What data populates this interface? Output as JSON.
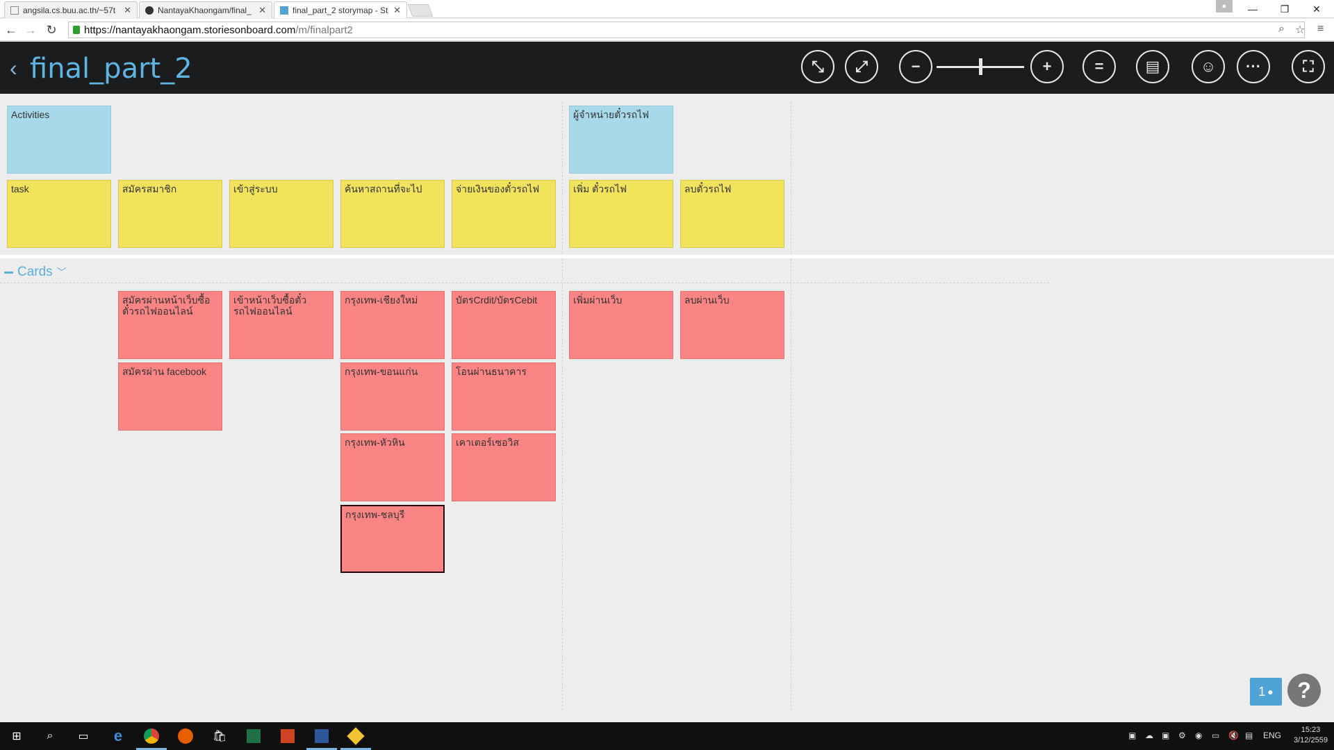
{
  "browser": {
    "tabs": [
      {
        "title": "angsila.cs.buu.ac.th/~57t",
        "active": false
      },
      {
        "title": "NantayaKhaongam/final_",
        "active": false
      },
      {
        "title": "final_part_2 storymap - St",
        "active": true
      }
    ],
    "url_host": "https://nantayakhaongam.storiesonboard.com",
    "url_path": "/m/finalpart2"
  },
  "header": {
    "title": "final_part_2",
    "buttons": [
      "collapse-icon",
      "expand-icon",
      "zoom-out-icon",
      "zoom-in-icon",
      "equal-icon",
      "notes-icon",
      "user-icon",
      "more-icon",
      "fullscreen-icon"
    ],
    "zoom_level": 0.5
  },
  "board": {
    "activities": [
      {
        "label": "Activities"
      },
      {
        "label": "ผู้จำหน่ายตั๋วรถไฟ"
      }
    ],
    "tasks": [
      {
        "label": "task"
      },
      {
        "label": "สมัครสมาชิก"
      },
      {
        "label": "เข้าสู่ระบบ"
      },
      {
        "label": "ค้นหาสถานที่จะไป"
      },
      {
        "label": "จ่ายเงินของตั๋วรถไฟ"
      },
      {
        "label": "เพิ่ม ตั๋วรถไฟ"
      },
      {
        "label": "ลบตั๋วรถไฟ"
      }
    ],
    "release_label": "Cards",
    "cards": [
      {
        "label": "สมัครผ่านหน้าเว็บซื้อตั๋วรถไฟออนไลน์"
      },
      {
        "label": "สมัครผ่าน facebook"
      },
      {
        "label": "เข้าหน้าเว็บซื้อตั๋วรถไฟออนไลน์"
      },
      {
        "label": "กรุงเทพ-เชียงใหม่"
      },
      {
        "label": "กรุงเทพ-ขอนแก่น"
      },
      {
        "label": "กรุงเทพ-หัวหิน"
      },
      {
        "label": "กรุงเทพ-ชลบุรี"
      },
      {
        "label": "บัตรCrdit/บัตรCebit"
      },
      {
        "label": "โอนผ่านธนาคาร"
      },
      {
        "label": "เคาเตอร์เซอวิส"
      },
      {
        "label": "เพิ่มผ่านเว็บ"
      },
      {
        "label": "ลบผ่านเว็บ"
      }
    ]
  },
  "floating": {
    "users_count": "1",
    "help": "?"
  },
  "taskbar": {
    "lang": "ENG",
    "time": "15:23",
    "date": "3/12/2559"
  },
  "colors": {
    "header_bg": "#1b1c1e",
    "title": "#5fb5e2",
    "activity": "#a8d9ea",
    "task": "#f2e35c",
    "card": "#fb8585"
  }
}
